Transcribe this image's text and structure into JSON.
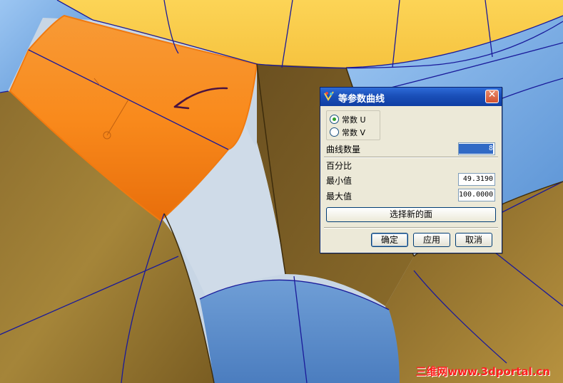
{
  "dialog": {
    "title": "等参数曲线",
    "close_glyph": "✕",
    "mode": {
      "options": [
        {
          "label": "常数 U",
          "selected": true
        },
        {
          "label": "常数 V",
          "selected": false
        }
      ]
    },
    "curve_count_label": "曲线数量",
    "curve_count_value": "8",
    "percent_label": "百分比",
    "min_label": "最小值",
    "min_value": "49.3190",
    "max_label": "最大值",
    "max_value": "100.0000",
    "select_new_face_label": "选择新的面",
    "ok_label": "确定",
    "apply_label": "应用",
    "cancel_label": "取消"
  },
  "watermark": "三维网www.3dportal.cn",
  "colors": {
    "selected_face": "#f5861e",
    "yellow_face": "#f9cc4a",
    "brown_face": "#9a7a35",
    "blue_face": "#7fb2e8",
    "edge_line": "#1a1a9a",
    "titlebar": "#1a4fb8"
  },
  "icons": [
    "app-icon",
    "close-icon",
    "arrow-annotation"
  ]
}
